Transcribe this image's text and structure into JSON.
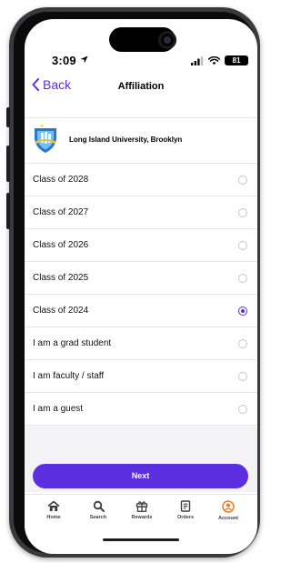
{
  "status_bar": {
    "time": "3:09",
    "battery": "81"
  },
  "nav": {
    "back_label": "Back",
    "title": "Affiliation"
  },
  "school": {
    "name": "Long Island University, Brooklyn"
  },
  "options": [
    {
      "label": "Class of 2028",
      "selected": false
    },
    {
      "label": "Class of 2027",
      "selected": false
    },
    {
      "label": "Class of 2026",
      "selected": false
    },
    {
      "label": "Class of 2025",
      "selected": false
    },
    {
      "label": "Class of 2024",
      "selected": true
    },
    {
      "label": "I am a grad student",
      "selected": false
    },
    {
      "label": "I am faculty / staff",
      "selected": false
    },
    {
      "label": "I am a guest",
      "selected": false
    }
  ],
  "next_button": {
    "label": "Next"
  },
  "tabs": [
    {
      "label": "Home",
      "icon": "home-icon"
    },
    {
      "label": "Search",
      "icon": "search-icon"
    },
    {
      "label": "Rewards",
      "icon": "gift-icon"
    },
    {
      "label": "Orders",
      "icon": "orders-icon"
    },
    {
      "label": "Account",
      "icon": "account-icon",
      "active": true
    }
  ],
  "colors": {
    "accent": "#5b2ee0",
    "account_icon": "#f07a1a"
  }
}
